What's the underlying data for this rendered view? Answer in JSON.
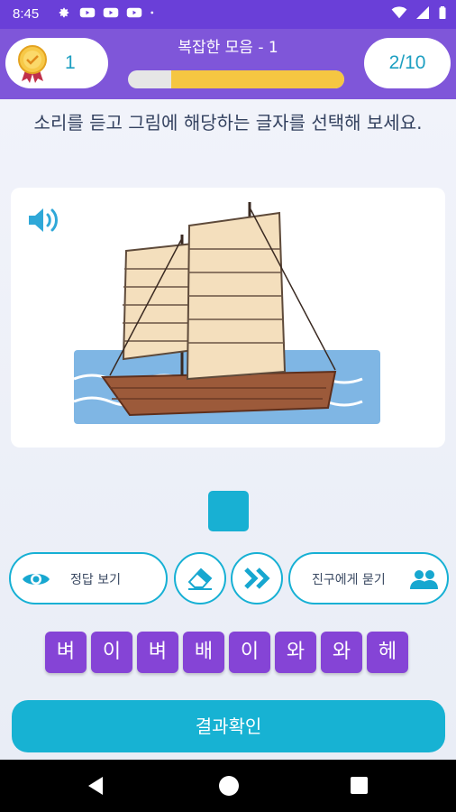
{
  "status_bar": {
    "time": "8:45",
    "icons": [
      "settings-icon",
      "youtube-icon",
      "youtube-icon",
      "youtube-icon",
      "dot-icon",
      "wifi-icon",
      "signal-icon",
      "battery-icon"
    ]
  },
  "header": {
    "score": "1",
    "level_title": "복잡한 모음 - 1",
    "progress_fraction": 0.2,
    "question_count": "2/10"
  },
  "instruction": "소리를 듣고 그림에 해당하는 글자를 선택해 보세요.",
  "image_card": {
    "speaker_icon": "speaker-icon",
    "picture": "sailing-ship"
  },
  "buttons": {
    "show_answer": "정답 보기",
    "ask_friend": "진구에게 묻기",
    "erase_icon": "eraser-icon",
    "skip_icon": "double-chevron-right-icon"
  },
  "tiles": [
    "벼",
    "이",
    "벼",
    "배",
    "이",
    "와",
    "와",
    "헤"
  ],
  "result_button": "결과확인",
  "colors": {
    "purple": "#7f56d9",
    "accent": "#17b2d3",
    "tile": "#8544d6",
    "progress": "#f5c642"
  }
}
